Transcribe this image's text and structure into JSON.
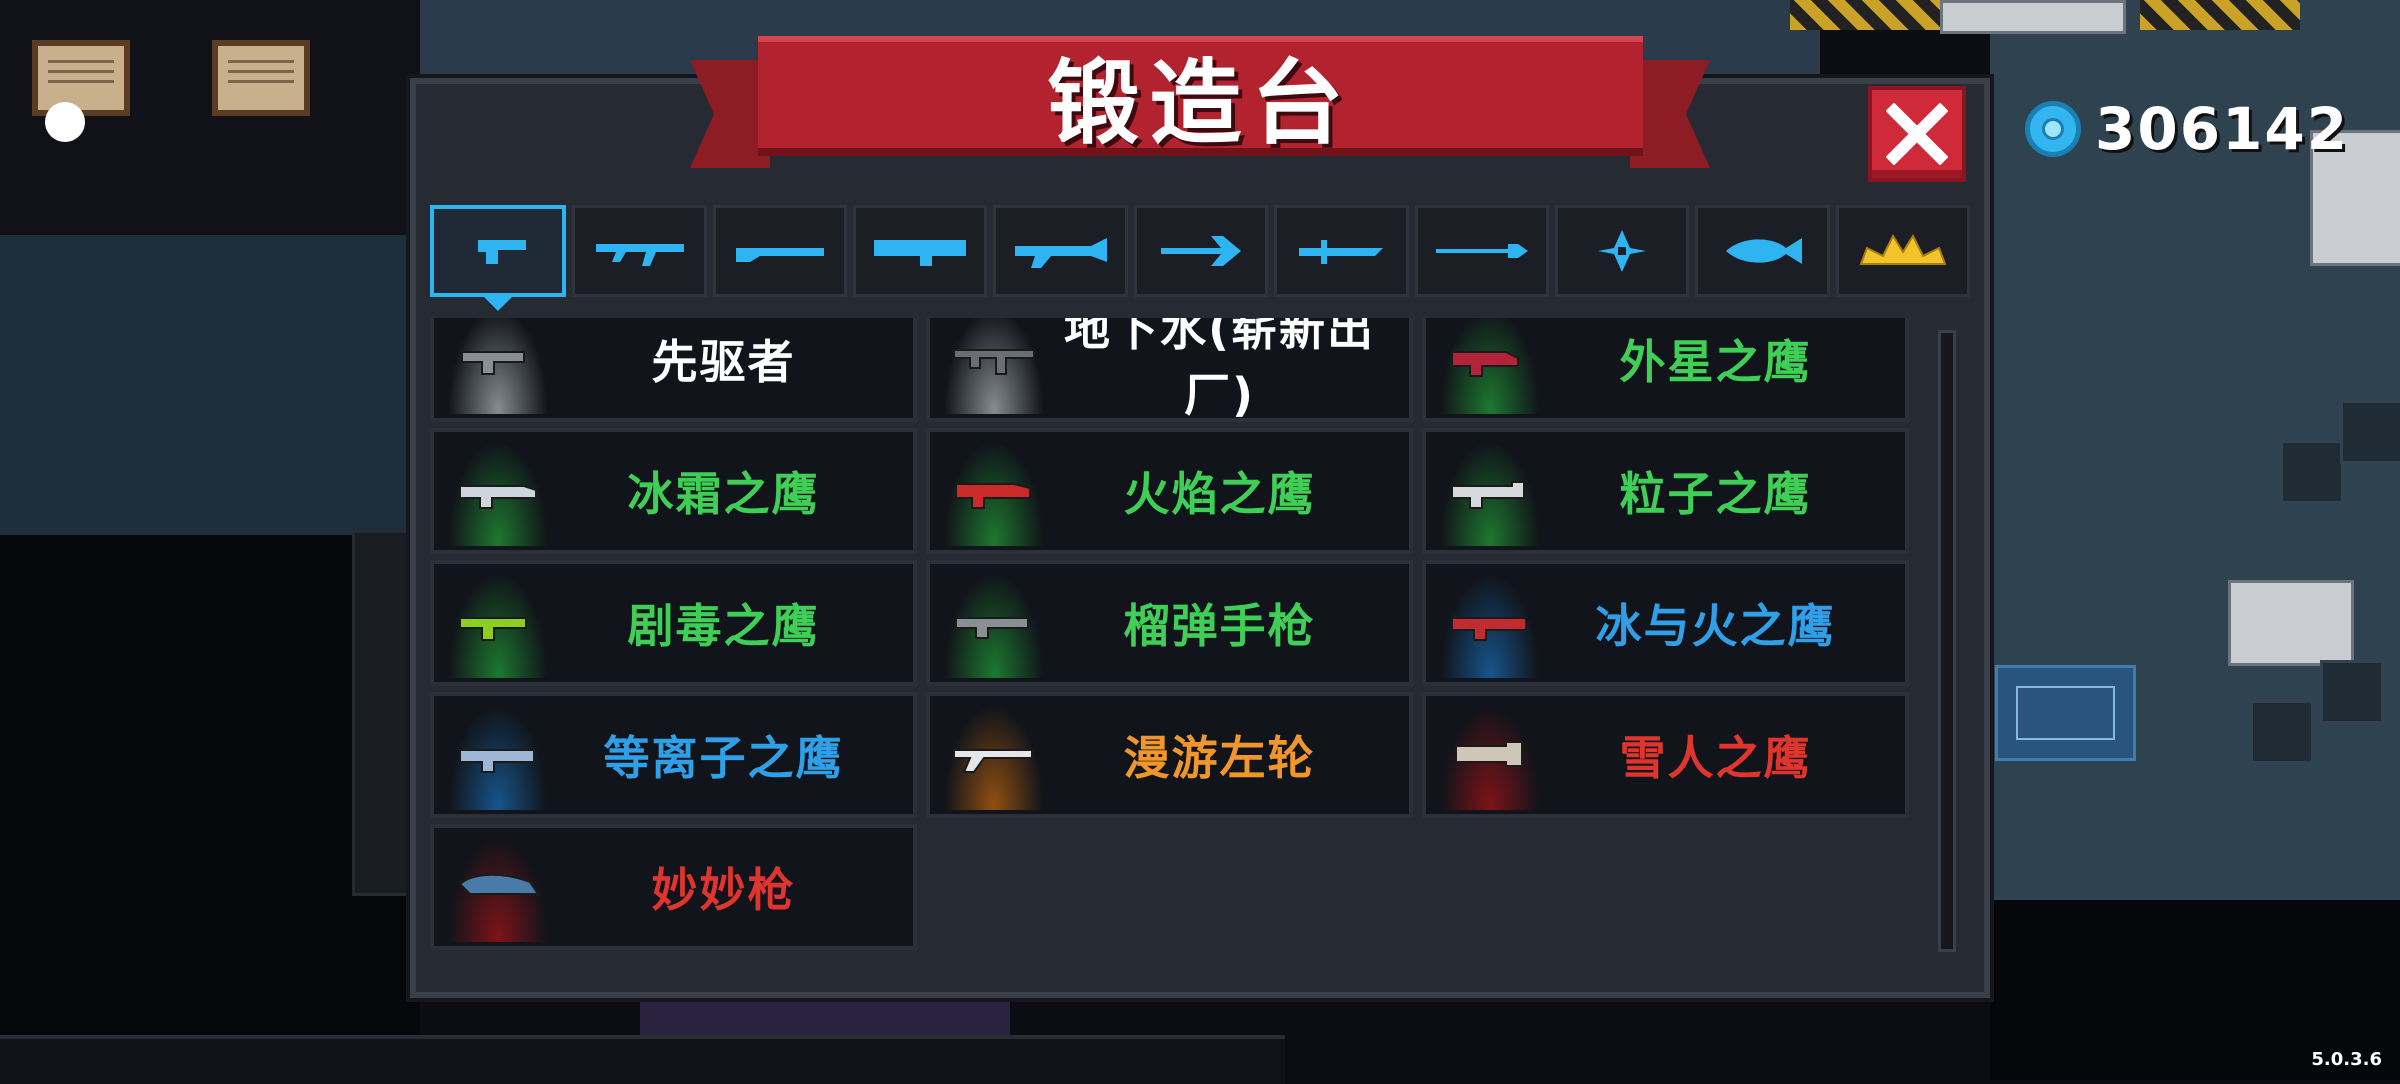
{
  "header": {
    "title": "锻造台"
  },
  "currency": {
    "value": "306142",
    "icon": "blue-gem-coin-icon"
  },
  "tabs": [
    {
      "icon": "pistol-icon",
      "selected": true
    },
    {
      "icon": "rifle-icon"
    },
    {
      "icon": "shotgun-icon"
    },
    {
      "icon": "launcher-icon"
    },
    {
      "icon": "special-gun-icon"
    },
    {
      "icon": "bow-icon"
    },
    {
      "icon": "sword-icon"
    },
    {
      "icon": "spear-icon"
    },
    {
      "icon": "shuriken-icon"
    },
    {
      "icon": "fish-icon"
    },
    {
      "icon": "crown-icon"
    }
  ],
  "items": [
    {
      "name": "先驱者",
      "color": "#ffffff",
      "glow": "#9aa0a8",
      "icon": "gray-gun-icon"
    },
    {
      "name": "地下水(崭新出厂)",
      "color": "#ffffff",
      "glow": "#9aa0a8",
      "icon": "smg-icon"
    },
    {
      "name": "外星之鹰",
      "color": "#3fcf56",
      "glow": "#1f8a33",
      "icon": "alien-eagle-gun-icon"
    },
    {
      "name": "冰霜之鹰",
      "color": "#3fcf56",
      "glow": "#1f8a33",
      "icon": "frost-eagle-gun-icon"
    },
    {
      "name": "火焰之鹰",
      "color": "#3fcf56",
      "glow": "#1f8a33",
      "icon": "fire-eagle-gun-icon"
    },
    {
      "name": "粒子之鹰",
      "color": "#3fcf56",
      "glow": "#1f8a33",
      "icon": "particle-eagle-gun-icon"
    },
    {
      "name": "剧毒之鹰",
      "color": "#3fcf56",
      "glow": "#1f8a33",
      "icon": "toxic-eagle-gun-icon"
    },
    {
      "name": "榴弹手枪",
      "color": "#3fcf56",
      "glow": "#1f8a33",
      "icon": "grenade-pistol-icon"
    },
    {
      "name": "冰与火之鹰",
      "color": "#2f9fe8",
      "glow": "#17609e",
      "icon": "ice-fire-eagle-gun-icon"
    },
    {
      "name": "等离子之鹰",
      "color": "#2f9fe8",
      "glow": "#17609e",
      "icon": "plasma-eagle-gun-icon"
    },
    {
      "name": "漫游左轮",
      "color": "#f0962a",
      "glow": "#a65a10",
      "icon": "revolver-icon"
    },
    {
      "name": "雪人之鹰",
      "color": "#e0352e",
      "glow": "#8f1418",
      "icon": "snowman-eagle-gun-icon"
    },
    {
      "name": "妙妙枪",
      "color": "#e0352e",
      "glow": "#8f1418",
      "icon": "turtle-gun-icon"
    }
  ],
  "footer": {
    "version": "5.0.3.6"
  },
  "colors": {
    "accent": "#2fb4f2",
    "banner": "#b3232f",
    "close": "#d0293a"
  }
}
